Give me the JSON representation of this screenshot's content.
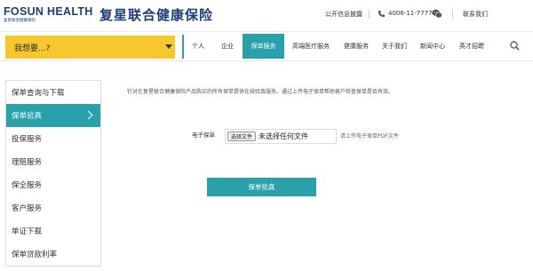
{
  "header": {
    "logo_text": "FOSUN HEALTH",
    "logo_sub": "复星联合健康保险",
    "brand_cn": "复星联合健康保险",
    "disclosure_link": "公开信息披露",
    "phone": "4006-11-7777",
    "contact_link": "联系我们",
    "icons": {
      "phone": "phone-icon",
      "wechat": "wechat-icon"
    }
  },
  "nav": {
    "want_label": "我想要...?",
    "items": [
      {
        "label": "个人"
      },
      {
        "label": "企业"
      },
      {
        "label": "保单服务"
      },
      {
        "label": "高端医疗服务"
      },
      {
        "label": "健康服务"
      },
      {
        "label": "关于我们"
      },
      {
        "label": "新闻中心"
      },
      {
        "label": "英才招聘"
      }
    ],
    "active_index": 2,
    "search_icon": "search-icon"
  },
  "sidebar": {
    "items": [
      {
        "label": "保单查询与下载"
      },
      {
        "label": "保单验真"
      },
      {
        "label": "投保服务"
      },
      {
        "label": "理赔服务"
      },
      {
        "label": "保全服务"
      },
      {
        "label": "客户服务"
      },
      {
        "label": "单证下载"
      },
      {
        "label": "保单贷款利率"
      }
    ],
    "active_index": 1
  },
  "main": {
    "intro": "针对在复星联合健康保险产品购买的所有保单提供在线验真服务。通过上传电子保单帮助客户检查保单是否有效。",
    "field_label": "电子保单",
    "file_button": "选择文件",
    "file_status": "未选择任何文件",
    "hint": "请上传电子保单PDF文件",
    "submit_label": "保单验真"
  },
  "colors": {
    "accent": "#2aa1aa",
    "want_bg": "#f6c72f",
    "brand_blue": "#1d3f7a"
  }
}
